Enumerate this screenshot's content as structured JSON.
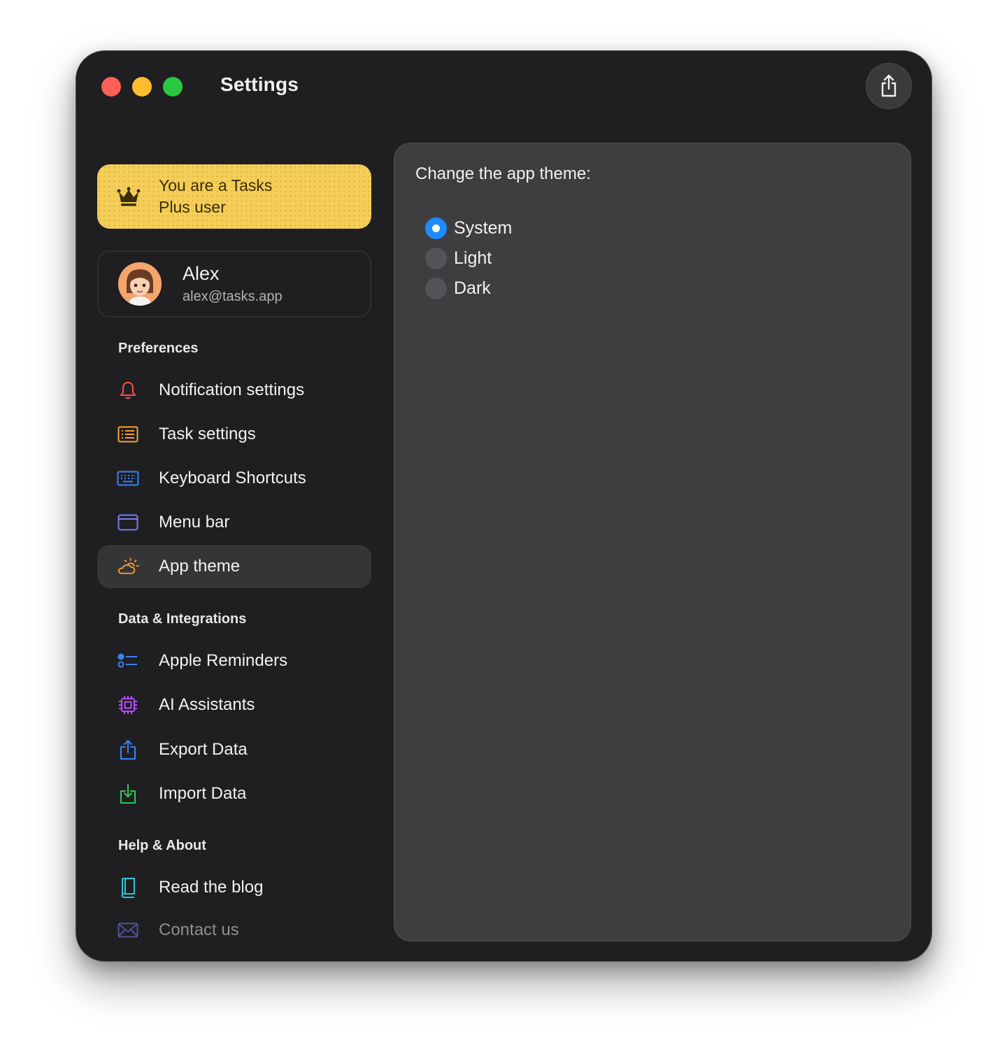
{
  "window": {
    "title": "Settings"
  },
  "plus": {
    "text": "You are a Tasks Plus user"
  },
  "user": {
    "name": "Alex",
    "email": "alex@tasks.app"
  },
  "sections": {
    "preferences": "Preferences",
    "data": "Data & Integrations",
    "help": "Help & About"
  },
  "nav": {
    "notifications": "Notification settings",
    "tasks": "Task settings",
    "keyboard": "Keyboard Shortcuts",
    "menubar": "Menu bar",
    "theme": "App theme",
    "reminders": "Apple Reminders",
    "ai": "AI Assistants",
    "export": "Export Data",
    "import": "Import Data",
    "blog": "Read the blog",
    "contact": "Contact us"
  },
  "content": {
    "title": "Change the app theme:",
    "options": [
      "System",
      "Light",
      "Dark"
    ],
    "selected": "System"
  },
  "colors": {
    "accent": "#1d8cff",
    "plus_card": "#f5ce58",
    "sidebar_bg": "#1f1f21",
    "panel_bg": "#3e3e41"
  }
}
